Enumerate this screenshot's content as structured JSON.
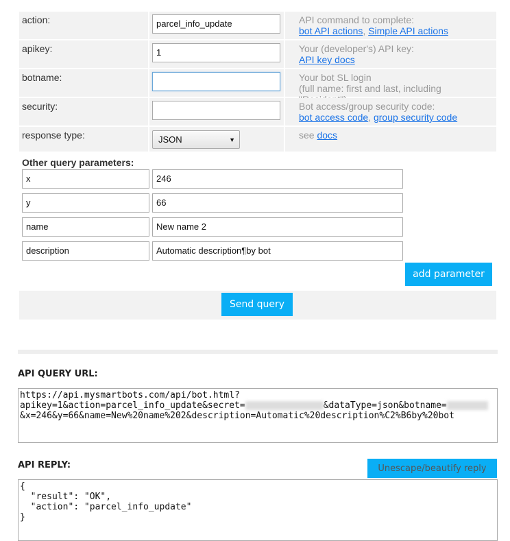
{
  "form": {
    "rows": [
      {
        "label": "action:",
        "value": "parcel_info_update",
        "hint": "API command to complete:",
        "links": [
          "bot API actions",
          "Simple API actions"
        ]
      },
      {
        "label": "apikey:",
        "value": "1",
        "hint": "Your (developer's) API key:",
        "links": [
          "API key docs"
        ]
      },
      {
        "label": "botname:",
        "value": "",
        "hint": "Your bot SL login",
        "hint2": "(full name: first and last, including \"Resident\")"
      },
      {
        "label": "security:",
        "value": "",
        "hint": "Bot access/group security code:",
        "links": [
          "bot access code",
          "group security code"
        ]
      },
      {
        "label": "response type:",
        "select": "JSON",
        "hint": "see",
        "links": [
          "docs"
        ]
      }
    ],
    "other_title": "Other query parameters:",
    "params": [
      {
        "name": "x",
        "value": "246"
      },
      {
        "name": "y",
        "value": "66"
      },
      {
        "name": "name",
        "value": "New name 2"
      },
      {
        "name": "description",
        "value": "Automatic description¶by bot"
      }
    ],
    "add_param": "add parameter",
    "send": "Send query"
  },
  "url": {
    "title": "API QUERY URL:",
    "line1": "https://api.mysmartbots.com/api/bot.html?",
    "line2a": "apikey=1&action=parcel_info_update&secret=",
    "line2b": "&dataType=json&botname=",
    "line3": "&x=246&y=66&name=New%20name%202&description=Automatic%20description%C2%B6by%20bot"
  },
  "reply": {
    "title": "API REPLY:",
    "button": "Unescape/beautify reply",
    "text": "{\n  \"result\": \"OK\",\n  \"action\": \"parcel_info_update\"\n}"
  },
  "colors": {
    "accent": "#0aaef5",
    "link": "#1a73e8",
    "panel": "#f2f2f2"
  }
}
